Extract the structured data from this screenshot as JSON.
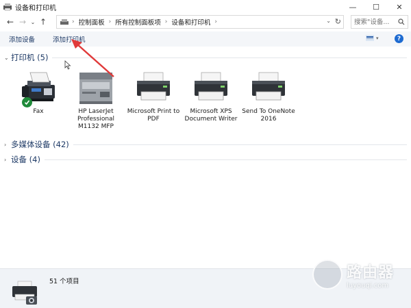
{
  "window": {
    "title": "设备和打印机",
    "minimize_glyph": "—",
    "maximize_glyph": "☐",
    "close_glyph": "✕"
  },
  "nav": {
    "back_glyph": "←",
    "forward_glyph": "→",
    "history_glyph": "⌄",
    "up_glyph": "↑"
  },
  "address": {
    "crumbs": [
      "控制面板",
      "所有控制面板项",
      "设备和打印机"
    ],
    "separator": "›",
    "dropdown_glyph": "⌄",
    "refresh_glyph": "↻"
  },
  "search": {
    "placeholder": "搜索\"设备...",
    "icon": "search-icon"
  },
  "commands": {
    "add_device": "添加设备",
    "add_printer": "添加打印机",
    "help": "?"
  },
  "groups": {
    "printers": {
      "caret": "⌄",
      "title": "打印机 (5)"
    },
    "multimedia": {
      "caret": "›",
      "title": "多媒体设备 (42)"
    },
    "devices": {
      "caret": "›",
      "title": "设备 (4)"
    }
  },
  "printers": [
    {
      "label": "Fax",
      "icon": "fax-icon",
      "default": false
    },
    {
      "label": "HP LaserJet Professional M1132 MFP",
      "icon": "mfp-printer-icon",
      "default": false
    },
    {
      "label": "Microsoft Print to PDF",
      "icon": "printer-icon",
      "default": true
    },
    {
      "label": "Microsoft XPS Document Writer",
      "icon": "printer-icon",
      "default": false
    },
    {
      "label": "Send To OneNote 2016",
      "icon": "printer-icon",
      "default": false
    }
  ],
  "status": {
    "count": "51 个项目"
  },
  "watermark": {
    "cn": "路由器",
    "en": "luyouqi.com"
  },
  "colors": {
    "accent": "#1e3a66",
    "help_blue": "#1e6bd1",
    "default_check": "#1f8a3a",
    "annotation_red": "#e03a3a",
    "cmdbar_bg": "#f4f6f9"
  }
}
